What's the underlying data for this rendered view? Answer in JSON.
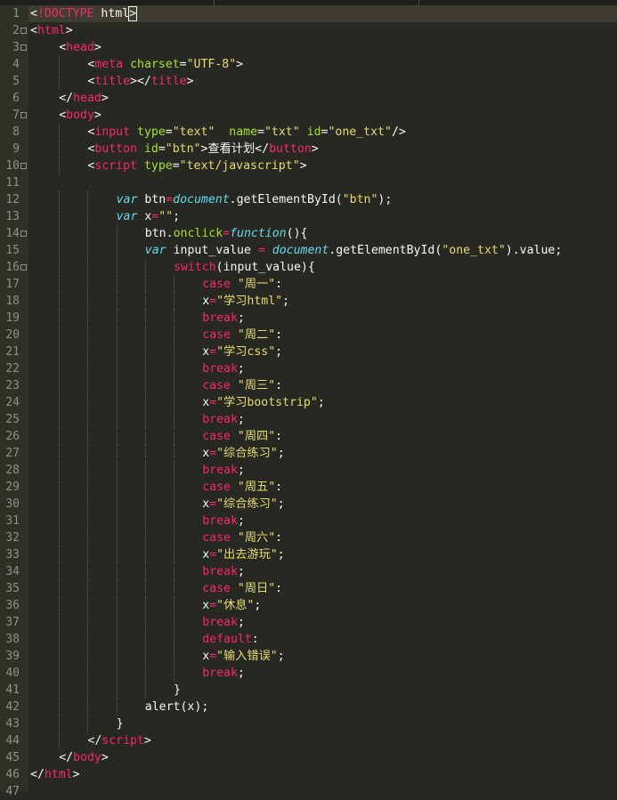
{
  "editor": {
    "theme_colors": {
      "background": "#272822",
      "gutter": "#2f3129",
      "line_number": "#8f908a",
      "tag": "#f92672",
      "attribute": "#a6e22e",
      "string": "#e6db74",
      "keyword": "#66d9ef",
      "text": "#f8f8f2"
    },
    "lines": [
      {
        "n": "1",
        "indent": 0,
        "fold": false,
        "current": true,
        "tokens": [
          {
            "t": "<",
            "c": "plain"
          },
          {
            "t": "!DOCTYPE",
            "c": "tag"
          },
          {
            "t": " html",
            "c": "plain"
          },
          {
            "t": ">",
            "c": "plain",
            "box": true
          }
        ]
      },
      {
        "n": "2",
        "indent": 0,
        "fold": true,
        "tokens": [
          {
            "t": "<",
            "c": "plain"
          },
          {
            "t": "html",
            "c": "tag"
          },
          {
            "t": ">",
            "c": "plain"
          }
        ]
      },
      {
        "n": "3",
        "indent": 1,
        "fold": true,
        "tokens": [
          {
            "t": "<",
            "c": "plain"
          },
          {
            "t": "head",
            "c": "tag"
          },
          {
            "t": ">",
            "c": "plain"
          }
        ]
      },
      {
        "n": "4",
        "indent": 2,
        "fold": false,
        "tokens": [
          {
            "t": "<",
            "c": "plain"
          },
          {
            "t": "meta",
            "c": "tag"
          },
          {
            "t": " ",
            "c": "plain"
          },
          {
            "t": "charset",
            "c": "attr"
          },
          {
            "t": "=",
            "c": "plain"
          },
          {
            "t": "\"UTF-8\"",
            "c": "str"
          },
          {
            "t": ">",
            "c": "plain"
          }
        ]
      },
      {
        "n": "5",
        "indent": 2,
        "fold": false,
        "tokens": [
          {
            "t": "<",
            "c": "plain"
          },
          {
            "t": "title",
            "c": "tag"
          },
          {
            "t": "></",
            "c": "plain"
          },
          {
            "t": "title",
            "c": "tag"
          },
          {
            "t": ">",
            "c": "plain"
          }
        ]
      },
      {
        "n": "6",
        "indent": 1,
        "fold": false,
        "tokens": [
          {
            "t": "</",
            "c": "plain"
          },
          {
            "t": "head",
            "c": "tag"
          },
          {
            "t": ">",
            "c": "plain"
          }
        ]
      },
      {
        "n": "7",
        "indent": 1,
        "fold": true,
        "tokens": [
          {
            "t": "<",
            "c": "plain"
          },
          {
            "t": "body",
            "c": "tag"
          },
          {
            "t": ">",
            "c": "plain"
          }
        ]
      },
      {
        "n": "8",
        "indent": 2,
        "fold": false,
        "tokens": [
          {
            "t": "<",
            "c": "plain"
          },
          {
            "t": "input",
            "c": "tag"
          },
          {
            "t": " ",
            "c": "plain"
          },
          {
            "t": "type",
            "c": "attr"
          },
          {
            "t": "=",
            "c": "plain"
          },
          {
            "t": "\"text\"",
            "c": "str"
          },
          {
            "t": "  ",
            "c": "plain"
          },
          {
            "t": "name",
            "c": "attr"
          },
          {
            "t": "=",
            "c": "plain"
          },
          {
            "t": "\"txt\"",
            "c": "str"
          },
          {
            "t": " ",
            "c": "plain"
          },
          {
            "t": "id",
            "c": "attr"
          },
          {
            "t": "=",
            "c": "plain"
          },
          {
            "t": "\"one_txt\"",
            "c": "str"
          },
          {
            "t": "/>",
            "c": "plain"
          }
        ]
      },
      {
        "n": "9",
        "indent": 2,
        "fold": false,
        "tokens": [
          {
            "t": "<",
            "c": "plain"
          },
          {
            "t": "button",
            "c": "tag"
          },
          {
            "t": " ",
            "c": "plain"
          },
          {
            "t": "id",
            "c": "attr"
          },
          {
            "t": "=",
            "c": "plain"
          },
          {
            "t": "\"btn\"",
            "c": "str"
          },
          {
            "t": ">查看计划</",
            "c": "plain"
          },
          {
            "t": "button",
            "c": "tag"
          },
          {
            "t": ">",
            "c": "plain"
          }
        ]
      },
      {
        "n": "10",
        "indent": 2,
        "fold": true,
        "tokens": [
          {
            "t": "<",
            "c": "plain"
          },
          {
            "t": "script",
            "c": "tag"
          },
          {
            "t": " ",
            "c": "plain"
          },
          {
            "t": "type",
            "c": "attr"
          },
          {
            "t": "=",
            "c": "plain"
          },
          {
            "t": "\"text/javascript\"",
            "c": "str"
          },
          {
            "t": ">",
            "c": "plain"
          }
        ]
      },
      {
        "n": "11",
        "indent": 0,
        "fold": false,
        "tokens": []
      },
      {
        "n": "12",
        "indent": 3,
        "fold": false,
        "tokens": [
          {
            "t": "var",
            "c": "var"
          },
          {
            "t": " btn",
            "c": "plain"
          },
          {
            "t": "=",
            "c": "kw"
          },
          {
            "t": "document",
            "c": "doc"
          },
          {
            "t": ".getElementById(",
            "c": "plain"
          },
          {
            "t": "\"btn\"",
            "c": "str"
          },
          {
            "t": ");",
            "c": "plain"
          }
        ]
      },
      {
        "n": "13",
        "indent": 3,
        "fold": false,
        "tokens": [
          {
            "t": "var",
            "c": "var"
          },
          {
            "t": " x",
            "c": "plain"
          },
          {
            "t": "=",
            "c": "kw"
          },
          {
            "t": "\"\"",
            "c": "str"
          },
          {
            "t": ";",
            "c": "plain"
          }
        ]
      },
      {
        "n": "14",
        "indent": 4,
        "fold": true,
        "tokens": [
          {
            "t": "btn.",
            "c": "plain"
          },
          {
            "t": "onclick",
            "c": "prop"
          },
          {
            "t": "=",
            "c": "kw"
          },
          {
            "t": "function",
            "c": "fn"
          },
          {
            "t": "(){",
            "c": "plain"
          }
        ]
      },
      {
        "n": "15",
        "indent": 4,
        "fold": false,
        "tokens": [
          {
            "t": "var",
            "c": "var"
          },
          {
            "t": " input_value ",
            "c": "plain"
          },
          {
            "t": "=",
            "c": "kw"
          },
          {
            "t": " ",
            "c": "plain"
          },
          {
            "t": "document",
            "c": "doc"
          },
          {
            "t": ".getElementById(",
            "c": "plain"
          },
          {
            "t": "\"one_txt\"",
            "c": "str"
          },
          {
            "t": ").value;",
            "c": "plain"
          }
        ]
      },
      {
        "n": "16",
        "indent": 5,
        "fold": true,
        "tokens": [
          {
            "t": "switch",
            "c": "kw"
          },
          {
            "t": "(input_value){",
            "c": "plain"
          }
        ]
      },
      {
        "n": "17",
        "indent": 6,
        "fold": false,
        "tokens": [
          {
            "t": "case",
            "c": "kw"
          },
          {
            "t": " ",
            "c": "plain"
          },
          {
            "t": "\"周一\"",
            "c": "str"
          },
          {
            "t": ":",
            "c": "plain"
          }
        ]
      },
      {
        "n": "18",
        "indent": 6,
        "fold": false,
        "tokens": [
          {
            "t": "x",
            "c": "plain"
          },
          {
            "t": "=",
            "c": "kw"
          },
          {
            "t": "\"学习html\"",
            "c": "str"
          },
          {
            "t": ";",
            "c": "plain"
          }
        ]
      },
      {
        "n": "19",
        "indent": 6,
        "fold": false,
        "tokens": [
          {
            "t": "break",
            "c": "kw"
          },
          {
            "t": ";",
            "c": "plain"
          }
        ]
      },
      {
        "n": "20",
        "indent": 6,
        "fold": false,
        "tokens": [
          {
            "t": "case",
            "c": "kw"
          },
          {
            "t": " ",
            "c": "plain"
          },
          {
            "t": "\"周二\"",
            "c": "str"
          },
          {
            "t": ":",
            "c": "plain"
          }
        ]
      },
      {
        "n": "21",
        "indent": 6,
        "fold": false,
        "tokens": [
          {
            "t": "x",
            "c": "plain"
          },
          {
            "t": "=",
            "c": "kw"
          },
          {
            "t": "\"学习css\"",
            "c": "str"
          },
          {
            "t": ";",
            "c": "plain"
          }
        ]
      },
      {
        "n": "22",
        "indent": 6,
        "fold": false,
        "tokens": [
          {
            "t": "break",
            "c": "kw"
          },
          {
            "t": ";",
            "c": "plain"
          }
        ]
      },
      {
        "n": "23",
        "indent": 6,
        "fold": false,
        "tokens": [
          {
            "t": "case",
            "c": "kw"
          },
          {
            "t": " ",
            "c": "plain"
          },
          {
            "t": "\"周三\"",
            "c": "str"
          },
          {
            "t": ":",
            "c": "plain"
          }
        ]
      },
      {
        "n": "24",
        "indent": 6,
        "fold": false,
        "tokens": [
          {
            "t": "x",
            "c": "plain"
          },
          {
            "t": "=",
            "c": "kw"
          },
          {
            "t": "\"学习bootstrip\"",
            "c": "str"
          },
          {
            "t": ";",
            "c": "plain"
          }
        ]
      },
      {
        "n": "25",
        "indent": 6,
        "fold": false,
        "tokens": [
          {
            "t": "break",
            "c": "kw"
          },
          {
            "t": ";",
            "c": "plain"
          }
        ]
      },
      {
        "n": "26",
        "indent": 6,
        "fold": false,
        "tokens": [
          {
            "t": "case",
            "c": "kw"
          },
          {
            "t": " ",
            "c": "plain"
          },
          {
            "t": "\"周四\"",
            "c": "str"
          },
          {
            "t": ":",
            "c": "plain"
          }
        ]
      },
      {
        "n": "27",
        "indent": 6,
        "fold": false,
        "tokens": [
          {
            "t": "x",
            "c": "plain"
          },
          {
            "t": "=",
            "c": "kw"
          },
          {
            "t": "\"综合练习\"",
            "c": "str"
          },
          {
            "t": ";",
            "c": "plain"
          }
        ]
      },
      {
        "n": "28",
        "indent": 6,
        "fold": false,
        "tokens": [
          {
            "t": "break",
            "c": "kw"
          },
          {
            "t": ";",
            "c": "plain"
          }
        ]
      },
      {
        "n": "29",
        "indent": 6,
        "fold": false,
        "tokens": [
          {
            "t": "case",
            "c": "kw"
          },
          {
            "t": " ",
            "c": "plain"
          },
          {
            "t": "\"周五\"",
            "c": "str"
          },
          {
            "t": ":",
            "c": "plain"
          }
        ]
      },
      {
        "n": "30",
        "indent": 6,
        "fold": false,
        "tokens": [
          {
            "t": "x",
            "c": "plain"
          },
          {
            "t": "=",
            "c": "kw"
          },
          {
            "t": "\"综合练习\"",
            "c": "str"
          },
          {
            "t": ";",
            "c": "plain"
          }
        ]
      },
      {
        "n": "31",
        "indent": 6,
        "fold": false,
        "tokens": [
          {
            "t": "break",
            "c": "kw"
          },
          {
            "t": ";",
            "c": "plain"
          }
        ]
      },
      {
        "n": "32",
        "indent": 6,
        "fold": false,
        "tokens": [
          {
            "t": "case",
            "c": "kw"
          },
          {
            "t": " ",
            "c": "plain"
          },
          {
            "t": "\"周六\"",
            "c": "str"
          },
          {
            "t": ":",
            "c": "plain"
          }
        ]
      },
      {
        "n": "33",
        "indent": 6,
        "fold": false,
        "tokens": [
          {
            "t": "x",
            "c": "plain"
          },
          {
            "t": "=",
            "c": "kw"
          },
          {
            "t": "\"出去游玩\"",
            "c": "str"
          },
          {
            "t": ";",
            "c": "plain"
          }
        ]
      },
      {
        "n": "34",
        "indent": 6,
        "fold": false,
        "tokens": [
          {
            "t": "break",
            "c": "kw"
          },
          {
            "t": ";",
            "c": "plain"
          }
        ]
      },
      {
        "n": "35",
        "indent": 6,
        "fold": false,
        "tokens": [
          {
            "t": "case",
            "c": "kw"
          },
          {
            "t": " ",
            "c": "plain"
          },
          {
            "t": "\"周日\"",
            "c": "str"
          },
          {
            "t": ":",
            "c": "plain"
          }
        ]
      },
      {
        "n": "36",
        "indent": 6,
        "fold": false,
        "tokens": [
          {
            "t": "x",
            "c": "plain"
          },
          {
            "t": "=",
            "c": "kw"
          },
          {
            "t": "\"休息\"",
            "c": "str"
          },
          {
            "t": ";",
            "c": "plain"
          }
        ]
      },
      {
        "n": "37",
        "indent": 6,
        "fold": false,
        "tokens": [
          {
            "t": "break",
            "c": "kw"
          },
          {
            "t": ";",
            "c": "plain"
          }
        ]
      },
      {
        "n": "38",
        "indent": 6,
        "fold": false,
        "tokens": [
          {
            "t": "default",
            "c": "kw"
          },
          {
            "t": ":",
            "c": "plain"
          }
        ]
      },
      {
        "n": "39",
        "indent": 6,
        "fold": false,
        "tokens": [
          {
            "t": "x",
            "c": "plain"
          },
          {
            "t": "=",
            "c": "kw"
          },
          {
            "t": "\"输入错误\"",
            "c": "str"
          },
          {
            "t": ";",
            "c": "plain"
          }
        ]
      },
      {
        "n": "40",
        "indent": 6,
        "fold": false,
        "tokens": [
          {
            "t": "break",
            "c": "kw"
          },
          {
            "t": ";",
            "c": "plain"
          }
        ]
      },
      {
        "n": "41",
        "indent": 5,
        "fold": false,
        "tokens": [
          {
            "t": "}",
            "c": "plain"
          }
        ]
      },
      {
        "n": "42",
        "indent": 4,
        "fold": false,
        "tokens": [
          {
            "t": "alert(x);",
            "c": "plain"
          }
        ]
      },
      {
        "n": "43",
        "indent": 3,
        "fold": false,
        "tokens": [
          {
            "t": "}",
            "c": "plain"
          }
        ]
      },
      {
        "n": "44",
        "indent": 2,
        "fold": false,
        "tokens": [
          {
            "t": "</",
            "c": "plain"
          },
          {
            "t": "script",
            "c": "tag"
          },
          {
            "t": ">",
            "c": "plain"
          }
        ]
      },
      {
        "n": "45",
        "indent": 1,
        "fold": false,
        "tokens": [
          {
            "t": "</",
            "c": "plain"
          },
          {
            "t": "body",
            "c": "tag"
          },
          {
            "t": ">",
            "c": "plain"
          }
        ]
      },
      {
        "n": "46",
        "indent": 0,
        "fold": false,
        "tokens": [
          {
            "t": "</",
            "c": "plain"
          },
          {
            "t": "html",
            "c": "tag"
          },
          {
            "t": ">",
            "c": "plain"
          }
        ]
      },
      {
        "n": "47",
        "indent": 0,
        "fold": false,
        "tokens": []
      }
    ]
  }
}
